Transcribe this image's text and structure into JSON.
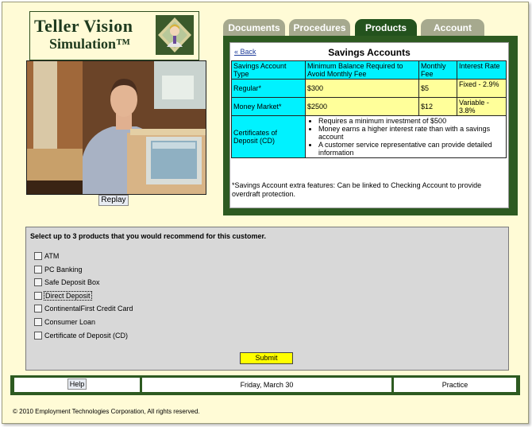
{
  "logo": {
    "line1": "Teller Vision",
    "line2": "Simulation™"
  },
  "video": {
    "replay_label": "Replay"
  },
  "tabs": [
    {
      "label": "Documents",
      "active": false
    },
    {
      "label": "Procedures",
      "active": false
    },
    {
      "label": "Products",
      "active": true
    },
    {
      "label": "Account",
      "active": false
    }
  ],
  "panel": {
    "back_label": "« Back",
    "title": "Savings Accounts",
    "headers": [
      "Savings Account Type",
      "Minimum Balance Required to Avoid Monthly Fee",
      "Monthly Fee",
      "Interest Rate"
    ],
    "rows": [
      {
        "type": "Regular*",
        "min_balance": "$300",
        "fee": "$5",
        "rate": "Fixed - 2.9%"
      },
      {
        "type": "Money Market*",
        "min_balance": "$2500",
        "fee": "$12",
        "rate": "Variable - 3.8%"
      }
    ],
    "cd": {
      "type": "Certificates of Deposit (CD)",
      "bullets": [
        "Requires a minimum investment of $500",
        "Money earns a higher interest rate than with a savings account",
        "A customer service representative can provide detailed information"
      ]
    },
    "footnote": "*Savings Account extra features: Can be linked to Checking Account to provide overdraft protection."
  },
  "question": {
    "prompt": "Select up to 3 products that you would recommend for this customer.",
    "options": [
      "ATM",
      "PC Banking",
      "Safe Deposit Box",
      "Direct Deposit",
      "ContinentalFirst Credit Card",
      "Consumer Loan",
      "Certificate of Deposit (CD)"
    ],
    "submit_label": "Submit"
  },
  "status": {
    "help_label": "Help",
    "date": "Friday, March 30",
    "mode": "Practice"
  },
  "footer": {
    "copyright": "© 2010 Employment Technologies Corporation, All rights reserved."
  },
  "colors": {
    "brand_green": "#23521d",
    "background": "#fffbd6",
    "table_cyan": "#00f2ff",
    "table_yellow": "#ffff9a",
    "submit_yellow": "#ffff00"
  },
  "icons": {
    "logo_image": "teller-portrait-icon"
  }
}
